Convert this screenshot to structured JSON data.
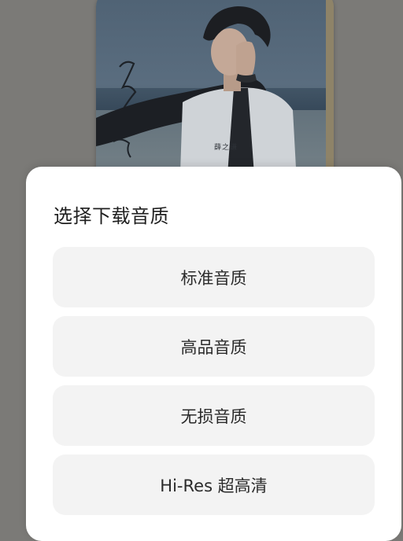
{
  "album": {
    "signature": "薛之谦"
  },
  "dialog": {
    "title": "选择下载音质",
    "options": [
      {
        "label": "标准音质"
      },
      {
        "label": "高品音质"
      },
      {
        "label": "无损音质"
      },
      {
        "label": "Hi-Res 超高清"
      }
    ]
  },
  "colors": {
    "overlay": "#7b7a77",
    "sheet_background": "#ffffff",
    "option_background": "#f3f3f3",
    "text_primary": "#1f1f1f"
  }
}
